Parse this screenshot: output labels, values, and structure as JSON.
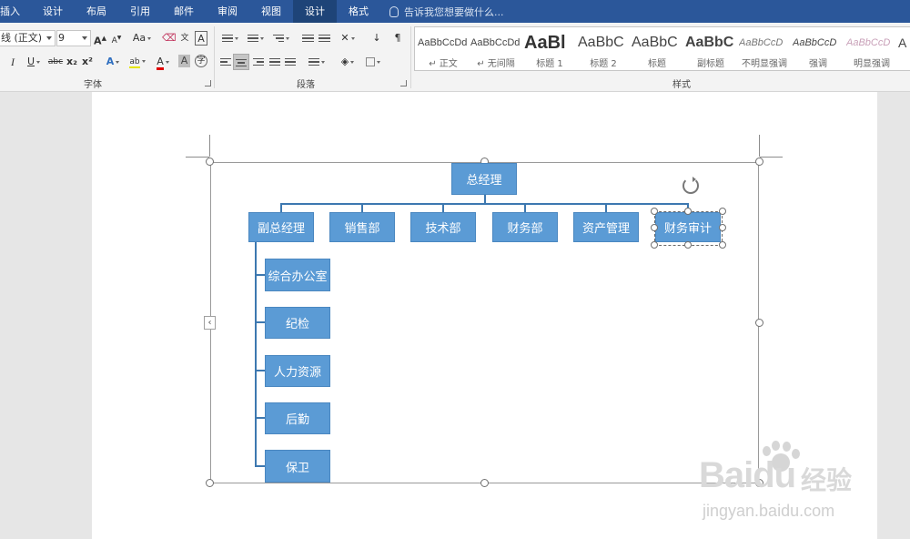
{
  "tabs": [
    {
      "id": "insert",
      "label": "插入"
    },
    {
      "id": "design",
      "label": "设计"
    },
    {
      "id": "layout",
      "label": "布局"
    },
    {
      "id": "references",
      "label": "引用"
    },
    {
      "id": "mailings",
      "label": "邮件"
    },
    {
      "id": "review",
      "label": "审阅"
    },
    {
      "id": "view",
      "label": "视图"
    },
    {
      "id": "smartart-design",
      "label": "设计"
    },
    {
      "id": "format",
      "label": "格式"
    }
  ],
  "tellme": "告诉我您想要做什么...",
  "font_group": {
    "font_name": "线 (正文)",
    "font_size": "9",
    "grow_label": "A",
    "shrink_label": "A",
    "change_case_label": "Aa",
    "phonetic_label": "文",
    "border_char_label": "A",
    "italic_label": "I",
    "underline_label": "U",
    "strike_label": "abc",
    "subscript_label": "x₂",
    "superscript_label": "x²",
    "text_effects_label": "A",
    "highlight_label": "ab",
    "font_color_label": "A",
    "char_shading_label": "A",
    "enclose_label": "字",
    "group_label": "字体"
  },
  "paragraph_group": {
    "group_label": "段落"
  },
  "styles_group": {
    "group_label": "样式",
    "items": [
      {
        "sample": "AaBbCcDd",
        "name": "↵ 正文"
      },
      {
        "sample": "AaBbCcDd",
        "name": "↵ 无间隔"
      },
      {
        "sample": "AaBl",
        "name": "标题 1"
      },
      {
        "sample": "AaBbC",
        "name": "标题 2"
      },
      {
        "sample": "AaBbC",
        "name": "标题"
      },
      {
        "sample": "AaBbC",
        "name": "副标题"
      },
      {
        "sample": "AaBbCcD",
        "name": "不明显强调"
      },
      {
        "sample": "AaBbCcD",
        "name": "强调"
      },
      {
        "sample": "AaBbCcD",
        "name": "明显强调"
      },
      {
        "sample": "A",
        "name": ""
      }
    ]
  },
  "org_chart": {
    "root": "总经理",
    "row1": [
      "副总经理",
      "销售部",
      "技术部",
      "财务部",
      "资产管理",
      "财务审计"
    ],
    "children": [
      "综合办公室",
      "纪检",
      "人力资源",
      "后勤",
      "保卫"
    ]
  },
  "watermark": {
    "brand_latin": "Bai",
    "brand_suffix": "du",
    "brand_cn": "经验",
    "url": "jingyan.baidu.com"
  }
}
